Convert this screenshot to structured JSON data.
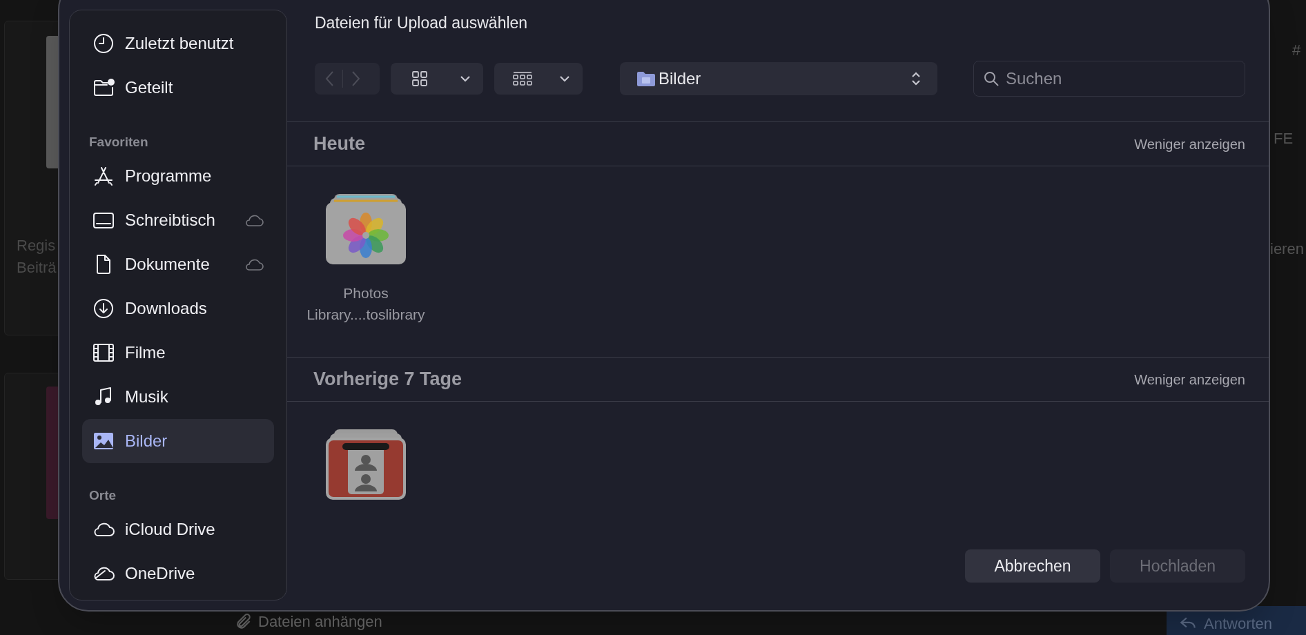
{
  "background": {
    "left_card_lines": [
      "Regis",
      "Beiträ"
    ],
    "right_texts": [
      "#",
      "FE",
      "ieren"
    ],
    "attach_button": "Dateien anhängen",
    "reply_button": "Antworten"
  },
  "dialog": {
    "title": "Dateien für Upload auswählen",
    "sidebar": {
      "sections": [
        {
          "items": [
            {
              "label": "Zuletzt benutzt",
              "kind": "clock",
              "cloud": false,
              "selected": false
            },
            {
              "label": "Geteilt",
              "kind": "shared",
              "cloud": false,
              "selected": false
            }
          ]
        },
        {
          "heading": "Favoriten",
          "items": [
            {
              "label": "Programme",
              "kind": "apps",
              "cloud": false,
              "selected": false
            },
            {
              "label": "Schreibtisch",
              "kind": "desktop",
              "cloud": true,
              "selected": false
            },
            {
              "label": "Dokumente",
              "kind": "document",
              "cloud": true,
              "selected": false
            },
            {
              "label": "Downloads",
              "kind": "download",
              "cloud": false,
              "selected": false
            },
            {
              "label": "Filme",
              "kind": "film",
              "cloud": false,
              "selected": false
            },
            {
              "label": "Musik",
              "kind": "music",
              "cloud": false,
              "selected": false
            },
            {
              "label": "Bilder",
              "kind": "picture",
              "cloud": false,
              "selected": true
            }
          ]
        },
        {
          "heading": "Orte",
          "items": [
            {
              "label": "iCloud Drive",
              "kind": "cloud",
              "cloud": false,
              "selected": false
            },
            {
              "label": "OneDrive",
              "kind": "onedrive",
              "cloud": false,
              "selected": false
            }
          ]
        }
      ]
    },
    "toolbar": {
      "back_disabled": true,
      "forward_disabled": true,
      "location": "Bilder",
      "search_placeholder": "Suchen"
    },
    "groups": [
      {
        "title": "Heute",
        "toggle": "Weniger anzeigen",
        "files": [
          {
            "name": "Photos Library....toslibrary",
            "kind": "photos"
          }
        ]
      },
      {
        "title": "Vorherige 7 Tage",
        "toggle": "Weniger anzeigen",
        "files": [
          {
            "kind": "booth"
          }
        ]
      }
    ],
    "buttons": [
      {
        "label": "Abbrechen",
        "disabled": false
      },
      {
        "label": "Hochladen",
        "disabled": true
      }
    ]
  }
}
